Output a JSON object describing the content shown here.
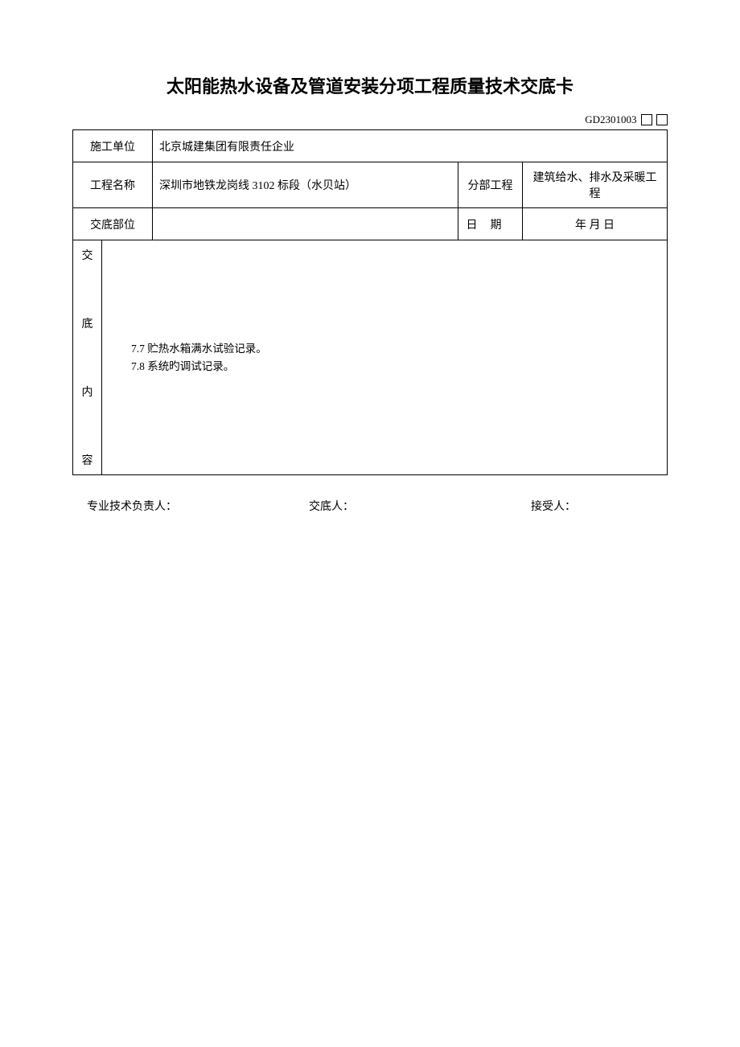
{
  "title": "太阳能热水设备及管道安装分项工程质量技术交底卡",
  "doc_code": "GD2301003",
  "labels": {
    "construction_unit": "施工单位",
    "project_name": "工程名称",
    "subdiv": "分部工程",
    "location": "交底部位",
    "date_label": "日期",
    "vertical": [
      "交",
      "底",
      "内",
      "容"
    ]
  },
  "values": {
    "construction_unit": "北京城建集团有限责任企业",
    "project_name": "深圳市地铁龙岗线 3102 标段（水贝站）",
    "subdiv": "建筑给水、排水及采暖工程",
    "location": "",
    "date": "年  月   日"
  },
  "content_lines": [
    "7.7 贮热水箱满水试验记录。",
    "7.8 系统旳调试记录。"
  ],
  "footer": {
    "tech_lead": "专业技术负责人：",
    "disclosed_by": "交底人：",
    "received_by": "接受人："
  }
}
